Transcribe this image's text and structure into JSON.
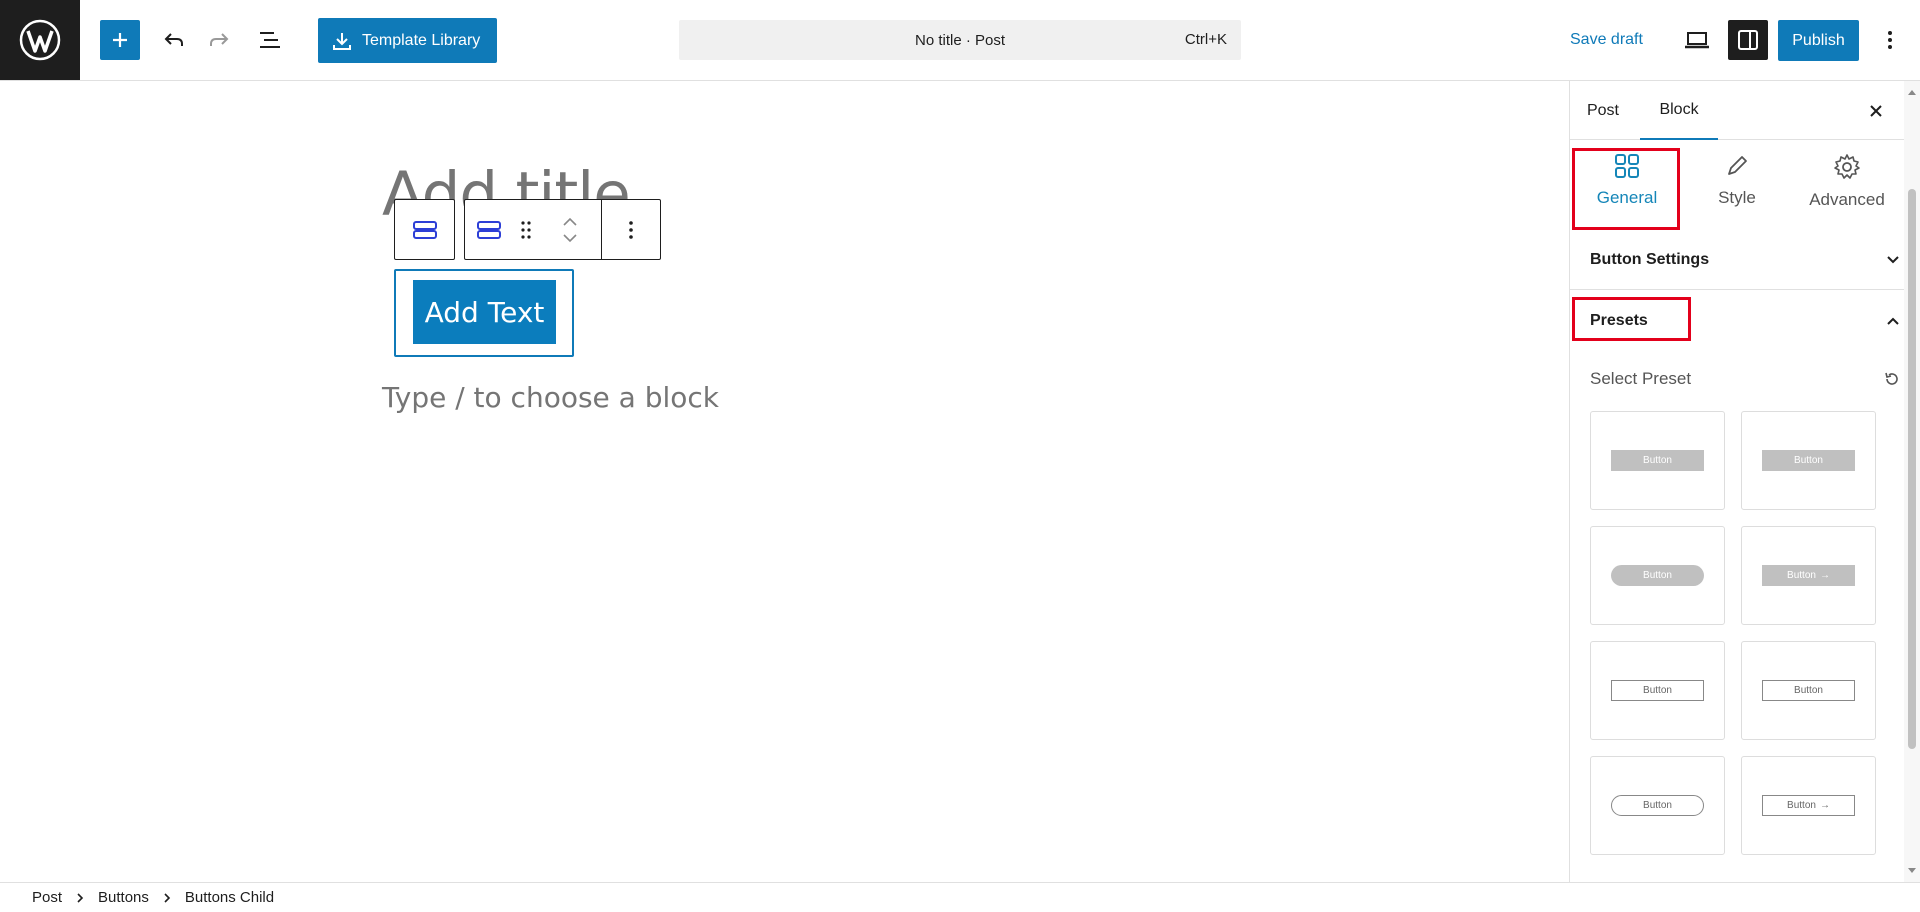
{
  "header": {
    "template_library_label": "Template Library",
    "command_bar_title": "No title · Post",
    "command_bar_shortcut": "Ctrl+K",
    "save_draft_label": "Save draft",
    "publish_label": "Publish"
  },
  "canvas": {
    "title_placeholder": "Add title",
    "button_text": "Add Text",
    "appender_placeholder": "Type / to choose a block"
  },
  "sidebar": {
    "tabs": [
      {
        "label": "Post",
        "active": false
      },
      {
        "label": "Block",
        "active": true
      }
    ],
    "sub_tabs": [
      {
        "label": "General",
        "icon": "grid-icon",
        "active": true
      },
      {
        "label": "Style",
        "icon": "pencil-icon",
        "active": false
      },
      {
        "label": "Advanced",
        "icon": "gear-icon",
        "active": false
      }
    ],
    "panels": {
      "button_settings": "Button Settings",
      "presets": "Presets"
    },
    "select_preset_label": "Select Preset",
    "presets": [
      {
        "label": "Button",
        "style": "filled"
      },
      {
        "label": "Button",
        "style": "filled"
      },
      {
        "label": "Button",
        "style": "pill"
      },
      {
        "label": "Button",
        "style": "filled-arrow"
      },
      {
        "label": "Button",
        "style": "outline"
      },
      {
        "label": "Button",
        "style": "outline"
      },
      {
        "label": "Button",
        "style": "outline-pill"
      },
      {
        "label": "Button",
        "style": "outline-arrow"
      }
    ]
  },
  "breadcrumb": [
    "Post",
    "Buttons",
    "Buttons Child"
  ],
  "colors": {
    "accent": "#0f7ab8",
    "highlight": "#e3001b",
    "dark": "#1e1e1e"
  }
}
